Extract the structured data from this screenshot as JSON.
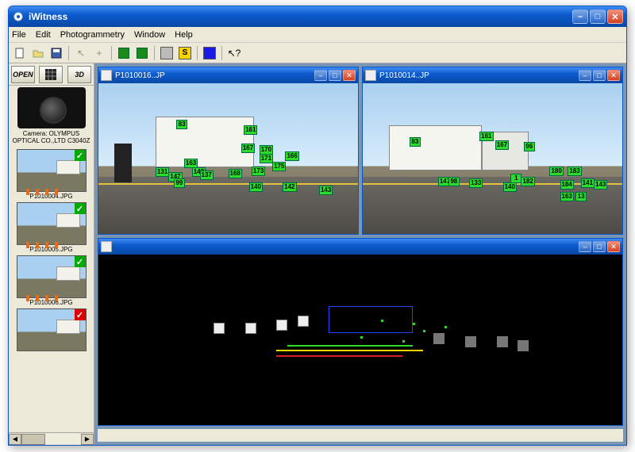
{
  "app": {
    "title": "iWitness"
  },
  "menu": {
    "file": "File",
    "edit": "Edit",
    "photo": "Photogrammetry",
    "window": "Window",
    "help": "Help"
  },
  "toolbar": {
    "new": "new-file-icon",
    "open": "open-file-icon",
    "save": "save-icon",
    "sbtn": "S",
    "arrow": "?",
    "color1": "#1a1ae8"
  },
  "sidebar": {
    "open_label": "OPEN",
    "grid_label": "grid",
    "threeD_label": "3D",
    "camera_label": "Camera: OLYMPUS OPTICAL CO.,LTD C3040Z",
    "thumbs": [
      {
        "file": "P1010004.JPG",
        "status": "green"
      },
      {
        "file": "P1010005.JPG",
        "status": "green"
      },
      {
        "file": "P1010006.JPG",
        "status": "green"
      },
      {
        "file": "",
        "status": "red"
      }
    ]
  },
  "imageA": {
    "file": "P1010016..JP",
    "markers": [
      {
        "id": "83",
        "x": 30,
        "y": 24
      },
      {
        "id": "161",
        "x": 56,
        "y": 28
      },
      {
        "id": "167",
        "x": 55,
        "y": 40
      },
      {
        "id": "170",
        "x": 62,
        "y": 41
      },
      {
        "id": "166",
        "x": 72,
        "y": 45
      },
      {
        "id": "171",
        "x": 62,
        "y": 47
      },
      {
        "id": "175",
        "x": 67,
        "y": 52
      },
      {
        "id": "173",
        "x": 59,
        "y": 55
      },
      {
        "id": "168",
        "x": 50,
        "y": 57
      },
      {
        "id": "163",
        "x": 33,
        "y": 50
      },
      {
        "id": "148",
        "x": 36,
        "y": 56
      },
      {
        "id": "131",
        "x": 22,
        "y": 56
      },
      {
        "id": "147",
        "x": 27,
        "y": 59
      },
      {
        "id": "99",
        "x": 29,
        "y": 63
      },
      {
        "id": "137",
        "x": 39,
        "y": 58
      },
      {
        "id": "140",
        "x": 58,
        "y": 66
      },
      {
        "id": "142",
        "x": 71,
        "y": 66
      },
      {
        "id": "143",
        "x": 85,
        "y": 68
      }
    ]
  },
  "imageB": {
    "file": "P1010014..JP",
    "markers": [
      {
        "id": "83",
        "x": 18,
        "y": 36
      },
      {
        "id": "161",
        "x": 45,
        "y": 32
      },
      {
        "id": "167",
        "x": 51,
        "y": 38
      },
      {
        "id": "96",
        "x": 62,
        "y": 39
      },
      {
        "id": "147",
        "x": 29,
        "y": 62
      },
      {
        "id": "98",
        "x": 33,
        "y": 62
      },
      {
        "id": "133",
        "x": 41,
        "y": 63
      },
      {
        "id": "140",
        "x": 54,
        "y": 66
      },
      {
        "id": "180",
        "x": 72,
        "y": 55
      },
      {
        "id": "183",
        "x": 79,
        "y": 55
      },
      {
        "id": "1",
        "x": 57,
        "y": 60
      },
      {
        "id": "182",
        "x": 61,
        "y": 62
      },
      {
        "id": "184",
        "x": 76,
        "y": 64
      },
      {
        "id": "141",
        "x": 84,
        "y": 63
      },
      {
        "id": "143",
        "x": 89,
        "y": 64
      },
      {
        "id": "163",
        "x": 76,
        "y": 72
      },
      {
        "id": "13",
        "x": 82,
        "y": 72
      }
    ]
  },
  "view3d": {
    "title": ""
  }
}
